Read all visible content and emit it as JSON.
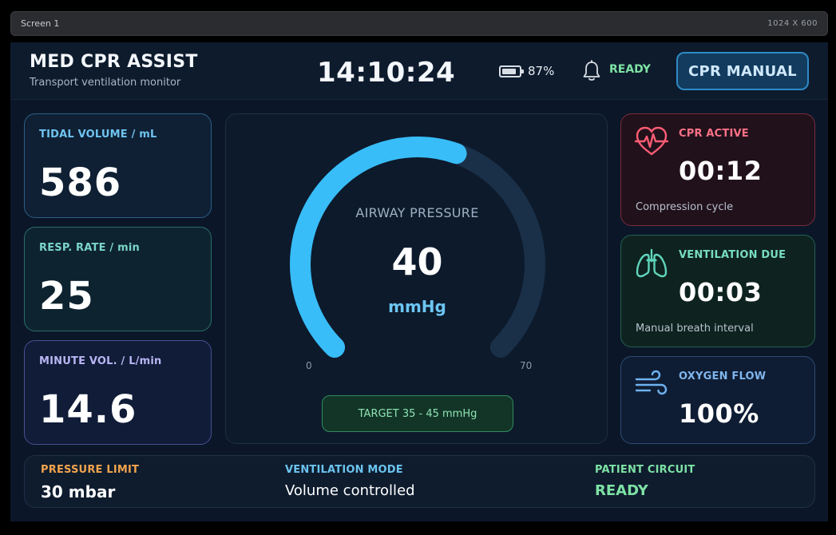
{
  "window": {
    "title": "Screen 1",
    "size_label": "1024 X 600"
  },
  "header": {
    "title": "MED CPR ASSIST",
    "subtitle": "Transport ventilation monitor",
    "clock": "14:10:24",
    "battery": {
      "percent": 87,
      "label": "87%",
      "icon": "battery-icon"
    },
    "alarm_icon": "bell-icon",
    "status": "READY",
    "cpr_button": "CPR MANUAL"
  },
  "metrics": [
    {
      "label": "TIDAL VOLUME / mL",
      "value": "586"
    },
    {
      "label": "RESP. RATE / min",
      "value": "25"
    },
    {
      "label": "MINUTE VOL. / L/min",
      "value": "14.6"
    }
  ],
  "gauge": {
    "title": "AIRWAY PRESSURE",
    "value": 40,
    "value_label": "40",
    "unit": "mmHg",
    "min": 0,
    "max": 70,
    "min_label": "0",
    "max_label": "70",
    "target": "TARGET 35 - 45 mmHg",
    "colors": {
      "fill": "#38bdf8",
      "track": "#1a3048"
    }
  },
  "status_cards": [
    {
      "icon": "heart-pulse-icon",
      "label": "CPR ACTIVE",
      "value": "00:12",
      "sub": "Compression cycle"
    },
    {
      "icon": "lungs-icon",
      "label": "VENTILATION DUE",
      "value": "00:03",
      "sub": "Manual breath interval"
    },
    {
      "icon": "wind-icon",
      "label": "OXYGEN FLOW",
      "value": "100%"
    }
  ],
  "footer": {
    "pressure_limit": {
      "label": "PRESSURE LIMIT",
      "value": "30 mbar"
    },
    "ventilation_mode": {
      "label": "VENTILATION MODE",
      "value": "Volume controlled"
    },
    "patient_circuit": {
      "label": "PATIENT CIRCUIT",
      "value": "READY"
    }
  }
}
